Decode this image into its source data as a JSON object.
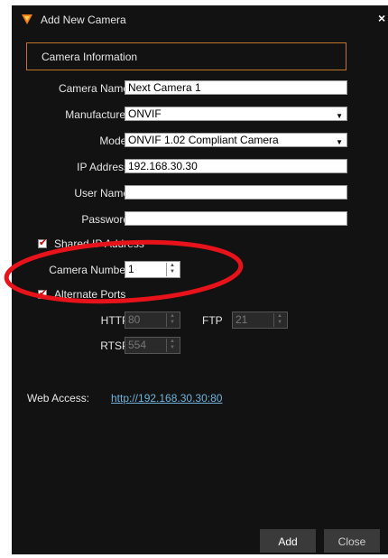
{
  "window": {
    "title": "Add New Camera",
    "close_glyph": "×"
  },
  "section": {
    "title": "Camera Information"
  },
  "fields": {
    "camera_name": {
      "label": "Camera Name",
      "value": "Next Camera 1"
    },
    "manufacturer": {
      "label": "Manufacturer",
      "value": "ONVIF"
    },
    "model": {
      "label": "Model",
      "value": "ONVIF 1.02 Compliant Camera"
    },
    "ip_address": {
      "label": "IP Address",
      "value": "192.168.30.30"
    },
    "user_name": {
      "label": "User Name",
      "value": ""
    },
    "password": {
      "label": "Password",
      "value": ""
    }
  },
  "shared_ip": {
    "label": "Shared IP Address",
    "checked": true
  },
  "camera_number": {
    "label": "Camera Number",
    "value": "1"
  },
  "alternate_ports": {
    "label": "Alternate Ports",
    "checked": true
  },
  "ports": {
    "http": {
      "label": "HTTP",
      "value": "80"
    },
    "ftp": {
      "label": "FTP",
      "value": "21"
    },
    "rtsp": {
      "label": "RTSP",
      "value": "554"
    }
  },
  "web_access": {
    "label": "Web Access:",
    "url": "http://192.168.30.30:80"
  },
  "buttons": {
    "add": "Add",
    "close": "Close"
  },
  "colors": {
    "background": "#121212",
    "accent_border": "#c2752a",
    "link": "#6fb3dc",
    "annotation": "#e8121a"
  }
}
